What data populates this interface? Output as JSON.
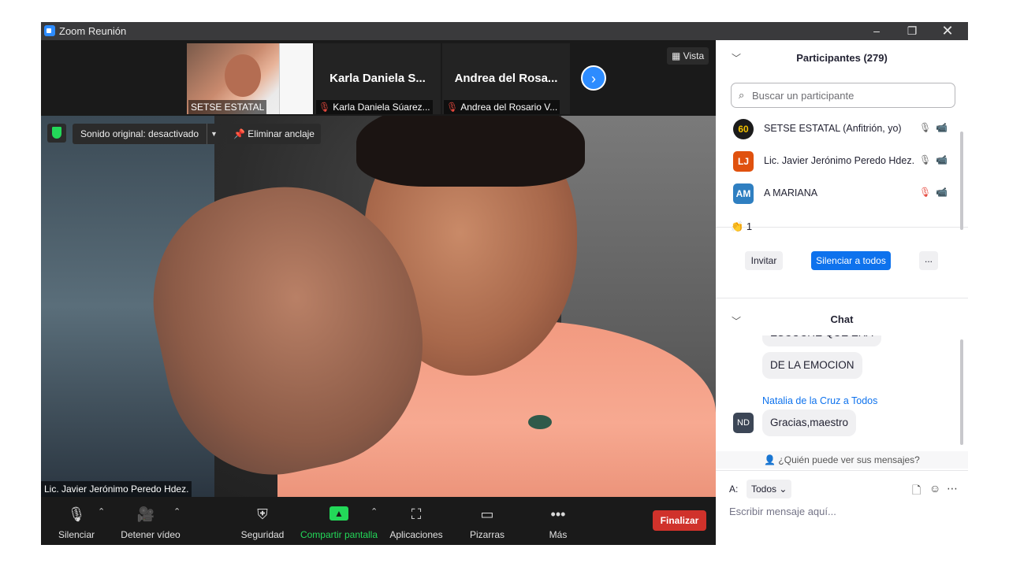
{
  "window": {
    "title": "Zoom Reunión",
    "minimize_glyph": "–",
    "restore_glyph": "❐",
    "close_glyph": "✕"
  },
  "strip": {
    "thumbnails": [
      {
        "label": "SETSE ESTATAL",
        "muted": false,
        "big_name": ""
      },
      {
        "label": "Karla Daniela  Súarez...",
        "muted": true,
        "big_name": "Karla Daniela  S..."
      },
      {
        "label": "Andrea del Rosario V...",
        "muted": true,
        "big_name": "Andrea del Rosa..."
      }
    ],
    "next_glyph": "›",
    "view_label": "Vista"
  },
  "main_video": {
    "sound_label": "Sonido original: desactivado",
    "unpin_label": "Eliminar anclaje",
    "speaker_name": "Lic. Javier Jerónimo Peredo Hdez."
  },
  "toolbar": {
    "mute": "Silenciar",
    "video": "Detener vídeo",
    "security": "Seguridad",
    "share": "Compartir pantalla",
    "apps": "Aplicaciones",
    "whiteboards": "Pizarras",
    "more": "Más",
    "end": "Finalizar"
  },
  "participants": {
    "title": "Participantes (279)",
    "search_placeholder": "Buscar un participante",
    "list": [
      {
        "initials": "60",
        "name": "SETSE ESTATAL (Anfitrión, yo)",
        "avatar_color": "#1b1b1b",
        "mic_off": false,
        "cam_off": false
      },
      {
        "initials": "LJ",
        "name": "Lic. Javier Jerónimo Peredo Hdez.",
        "avatar_color": "#e0510e",
        "mic_off": false,
        "cam_off": false
      },
      {
        "initials": "AM",
        "name": "A MARIANA",
        "avatar_color": "#2f7fc1",
        "mic_off": true,
        "cam_off": true
      }
    ],
    "reaction_count": "1",
    "invite": "Invitar",
    "mute_all": "Silenciar a todos",
    "more": "..."
  },
  "chat": {
    "title": "Chat",
    "partial_message": "ESCUCHE QUE ERA",
    "message_1": "DE LA EMOCION",
    "sender_2": "Natalia de la Cruz a Todos",
    "sender_2_initials": "ND",
    "message_2": "Gracias,maestro",
    "privacy": "¿Quién puede ver sus mensajes?",
    "to_label": "A:",
    "to_value": "Todos",
    "input_placeholder": "Escribir mensaje aquí..."
  },
  "colors": {
    "accent": "#0e72ed",
    "share_green": "#23d959",
    "end_red": "#d0322b"
  }
}
